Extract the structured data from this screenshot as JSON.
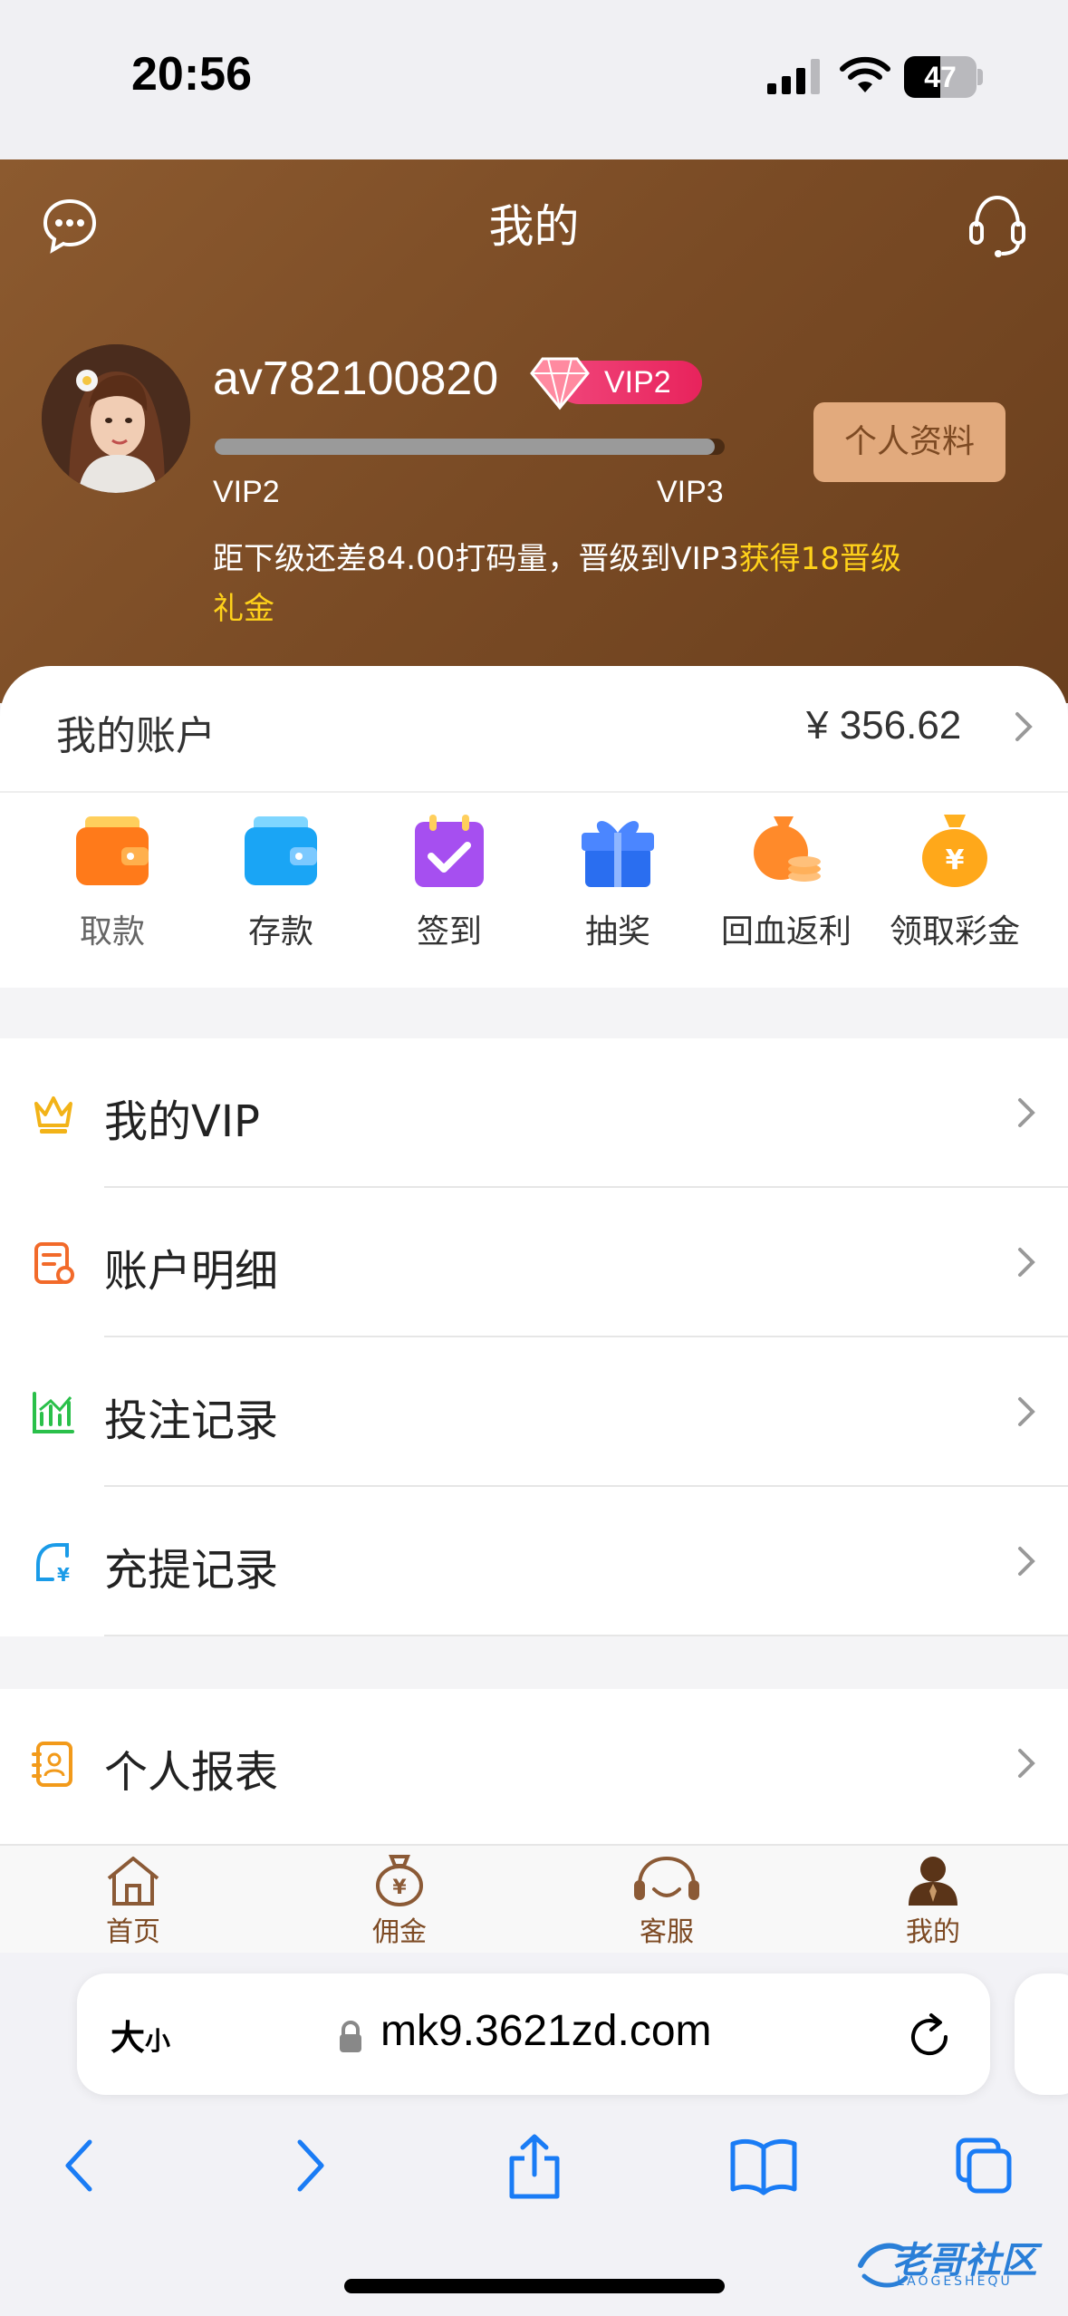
{
  "status_bar": {
    "time": "20:56",
    "battery": "47"
  },
  "header": {
    "title": "我的",
    "username": "av782100820",
    "vip_badge": "VIP2",
    "progress_fraction": 0.98,
    "level_current": "VIP2",
    "level_next": "VIP3",
    "hint_prefix": "距下级还差84.00打码量，晋级到VIP3",
    "hint_highlight": "获得18晋级礼金",
    "profile_button": "个人资料"
  },
  "account": {
    "label": "我的账户",
    "amount": "¥ 356.62"
  },
  "actions": [
    {
      "label": "取款",
      "icon": "wallet-withdraw-icon"
    },
    {
      "label": "存款",
      "icon": "wallet-deposit-icon"
    },
    {
      "label": "签到",
      "icon": "calendar-check-icon"
    },
    {
      "label": "抽奖",
      "icon": "gift-icon"
    },
    {
      "label": "回血返利",
      "icon": "coin-bag-icon"
    },
    {
      "label": "领取彩金",
      "icon": "money-bag-icon"
    }
  ],
  "menu_group_1": [
    {
      "label": "我的VIP",
      "icon": "crown-icon"
    },
    {
      "label": "账户明细",
      "icon": "receipt-icon"
    },
    {
      "label": "投注记录",
      "icon": "bar-chart-icon"
    },
    {
      "label": "充提记录",
      "icon": "refresh-yen-icon"
    }
  ],
  "menu_group_2": [
    {
      "label": "个人报表",
      "icon": "contacts-book-icon"
    }
  ],
  "tabbar": [
    {
      "label": "首页",
      "icon": "home-icon"
    },
    {
      "label": "佣金",
      "icon": "commission-bag-icon"
    },
    {
      "label": "客服",
      "icon": "headset-icon"
    },
    {
      "label": "我的",
      "icon": "person-icon"
    }
  ],
  "browser": {
    "text_size": "大",
    "text_size_small": "小",
    "url": "mk9.3621zd.com"
  },
  "watermark": {
    "text": "老哥社区",
    "sub": "LAOGESHEQU"
  },
  "colors": {
    "header_brown": "#7a4b25",
    "accent_gold": "#ffd21a",
    "vip_pink": "#e8235c",
    "tab_brown": "#7d4a23"
  }
}
